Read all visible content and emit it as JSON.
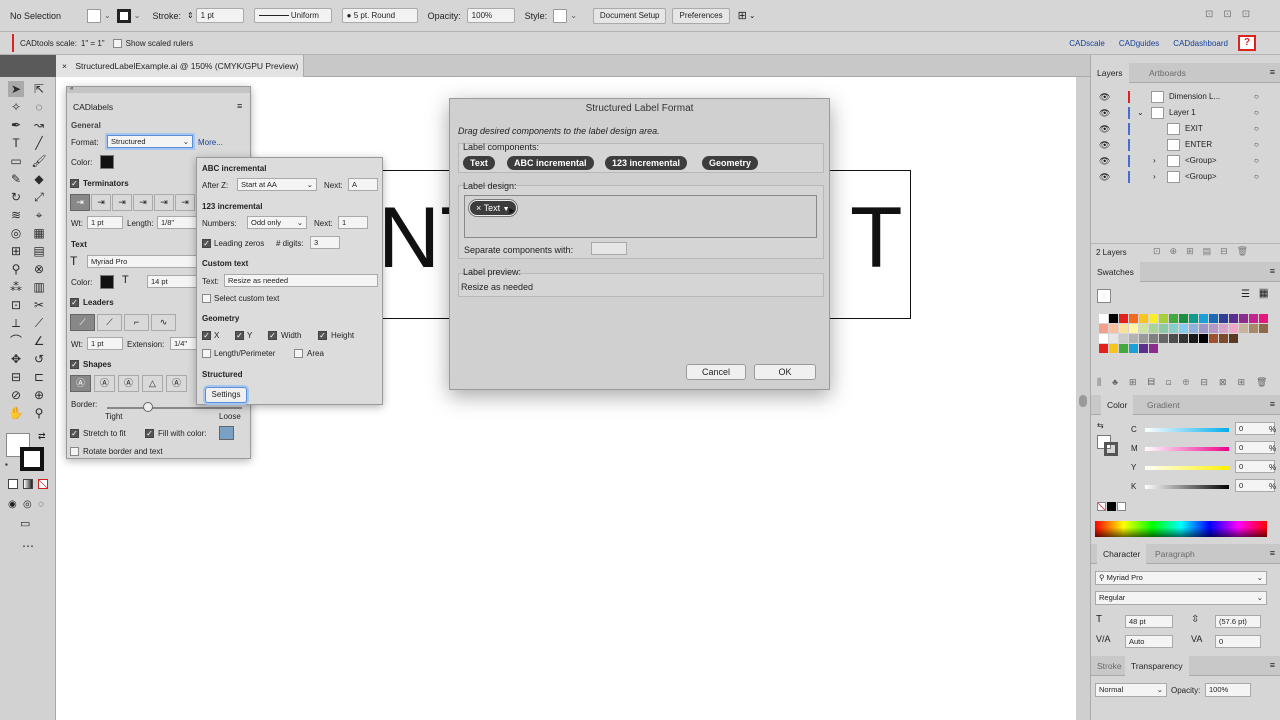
{
  "control_bar": {
    "selection": "No Selection",
    "stroke_label": "Stroke:",
    "stroke_weight": "1 pt",
    "stroke_profile": "Uniform",
    "brush": "5 pt. Round",
    "opacity_label": "Opacity:",
    "opacity": "100%",
    "style_label": "Style:",
    "document_setup": "Document Setup",
    "preferences": "Preferences"
  },
  "cad_bar": {
    "scale_label": "CADtools scale:",
    "scale_value": "1\" = 1\"",
    "show_scaled_rulers": "Show scaled rulers",
    "links": [
      "CADscale",
      "CADguides",
      "CADdashboard"
    ],
    "help": "?"
  },
  "document_tab": {
    "close": "×",
    "title": "StructuredLabelExample.ai @ 150% (CMYK/GPU Preview)"
  },
  "canvas": {
    "left_text": "NT",
    "right_text": "T"
  },
  "cadlabels": {
    "title": "CADlabels",
    "general": "General",
    "format_label": "Format:",
    "format_value": "Structured",
    "more": "More...",
    "color_label": "Color:",
    "terminators": "Terminators",
    "wt_label": "Wt:",
    "wt_value": "1 pt",
    "length_label": "Length:",
    "length_value": "1/8\"",
    "text_section": "Text",
    "font": "Myriad Pro",
    "text_color_label": "Color:",
    "font_size": "14 pt",
    "leaders": "Leaders",
    "leader_wt_label": "Wt:",
    "leader_wt_value": "1 pt",
    "extension_label": "Extension:",
    "extension_value": "1/4\"",
    "shapes": "Shapes",
    "border_label": "Border:",
    "tight": "Tight",
    "loose": "Loose",
    "stretch_to_fit": "Stretch to fit",
    "fill_with_color": "Fill with color:",
    "rotate": "Rotate border and text",
    "fill_color": "#7aa0c4"
  },
  "more_panel": {
    "abc_title": "ABC incremental",
    "after_z_label": "After Z:",
    "after_z_value": "Start at AA",
    "next_label": "Next:",
    "abc_next": "A",
    "num_title": "123 incremental",
    "numbers_label": "Numbers:",
    "numbers_value": "Odd only",
    "num_next_label": "Next:",
    "num_next": "1",
    "leading_zeros": "Leading zeros",
    "digits_label": "# digits:",
    "digits_value": "3",
    "custom_title": "Custom text",
    "text_label": "Text:",
    "text_value": "Resize as needed",
    "select_custom": "Select custom text",
    "geometry_title": "Geometry",
    "geo_x": "X",
    "geo_y": "Y",
    "geo_width": "Width",
    "geo_height": "Height",
    "length_perimeter": "Length/Perimeter",
    "area": "Area",
    "structured_title": "Structured",
    "settings": "Settings"
  },
  "dialog": {
    "title": "Structured Label Format",
    "instruction": "Drag desired components to the label design area.",
    "components_label": "Label components:",
    "components": [
      "Text",
      "ABC incremental",
      "123 incremental",
      "Geometry"
    ],
    "design_label": "Label design:",
    "design_token": "Text",
    "token_remove": "×",
    "separate_label": "Separate components with:",
    "preview_label": "Label preview:",
    "preview_value": "Resize as needed",
    "cancel": "Cancel",
    "ok": "OK"
  },
  "layers_panel": {
    "tabs": [
      "Layers",
      "Artboards"
    ],
    "rows": [
      {
        "name": "Dimension L...",
        "color": "#e02020"
      },
      {
        "name": "Layer 1",
        "color": "#4a6cd6"
      },
      {
        "name": "EXIT",
        "color": "#4a6cd6"
      },
      {
        "name": "ENTER",
        "color": "#4a6cd6"
      },
      {
        "name": "<Group>",
        "color": "#4a6cd6"
      },
      {
        "name": "<Group>",
        "color": "#4a6cd6"
      }
    ],
    "footer": "2 Layers"
  },
  "swatches_panel": {
    "title": "Swatches",
    "row1": [
      "#ffffff",
      "#000000",
      "#e3201b",
      "#f06b1e",
      "#f7c51d",
      "#f7ee25",
      "#a8ce3a",
      "#43a93e",
      "#1d8d3f",
      "#119b8c",
      "#1a9fd9",
      "#1b6bb5",
      "#2d3f96",
      "#5b2f8e",
      "#8c2d8e",
      "#c2268b",
      "#e5177d",
      "#e52a4f"
    ],
    "row2": [
      "#f3a08a",
      "#f8c19b",
      "#fbe19c",
      "#fef6a2",
      "#cfe3a0",
      "#a8d49c",
      "#8ccaa5",
      "#86cfc9",
      "#87cbef",
      "#8fb1dc",
      "#9b97c9",
      "#b698c7",
      "#d6a2cb",
      "#f2a6c6",
      "#c8b49a",
      "#a88968",
      "#8c6a4a",
      "#6c4f36"
    ],
    "row3": [
      "#ffffff",
      "#e6e6e6",
      "#cccccc",
      "#b3b3b3",
      "#999999",
      "#808080",
      "#666666",
      "#4d4d4d",
      "#333333",
      "#1a1a1a",
      "#000000",
      "#a0522d",
      "#7a4a2a",
      "#5a3a24"
    ],
    "row4": [
      "#e3201b",
      "#f7c51d",
      "#43a93e",
      "#1a9fd9",
      "#5b2f8e",
      "#8c2d8e"
    ]
  },
  "color_panel": {
    "tabs": [
      "Color",
      "Gradient"
    ],
    "channels": [
      {
        "name": "C",
        "value": "0",
        "unit": "%"
      },
      {
        "name": "M",
        "value": "0",
        "unit": "%"
      },
      {
        "name": "Y",
        "value": "0",
        "unit": "%"
      },
      {
        "name": "K",
        "value": "0",
        "unit": "%"
      }
    ]
  },
  "character_panel": {
    "tabs": [
      "Character",
      "Paragraph"
    ],
    "font": "Myriad Pro",
    "style": "Regular",
    "size": "48 pt",
    "leading": "(57.6 pt)",
    "kerning": "Auto",
    "tracking": "0"
  },
  "transparency_panel": {
    "tabs": [
      "Stroke",
      "Transparency"
    ],
    "mode": "Normal",
    "opacity_label": "Opacity:",
    "opacity": "100%"
  }
}
